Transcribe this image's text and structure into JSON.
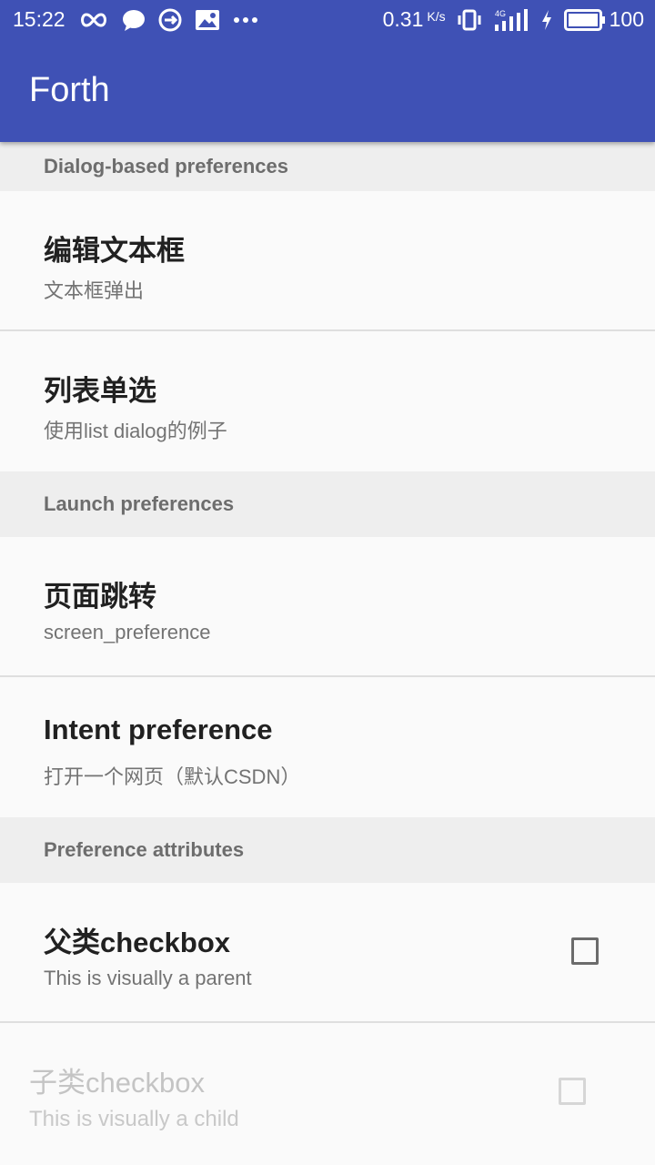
{
  "status_bar": {
    "time": "15:22",
    "net_speed": "0.31",
    "net_unit": "K/s",
    "network_type": "4G",
    "battery_level": "100",
    "left_icons": [
      "infinity-icon",
      "chat-bubble-icon",
      "sync-icon",
      "image-message-icon",
      "more-dots-icon"
    ],
    "right_icons": [
      "vibrate-icon",
      "signal-icon",
      "charging-icon",
      "battery-icon"
    ]
  },
  "app_bar": {
    "title": "Forth",
    "color": "#3f51b5"
  },
  "sections": [
    {
      "header": "Dialog-based preferences",
      "items": [
        {
          "title": "编辑文本框",
          "summary": "文本框弹出"
        },
        {
          "title": "列表单选",
          "summary": "使用list dialog的例子"
        }
      ]
    },
    {
      "header": "Launch preferences",
      "items": [
        {
          "title": "页面跳转",
          "summary": "screen_preference"
        },
        {
          "title": "Intent preference",
          "summary": "打开一个网页（默认CSDN）"
        }
      ]
    },
    {
      "header": "Preference attributes",
      "items": [
        {
          "title": "父类checkbox",
          "summary": "This is visually a parent",
          "checkbox": true,
          "checked": false,
          "enabled": true
        },
        {
          "title": "子类checkbox",
          "summary": "This is visually a child",
          "checkbox": true,
          "checked": false,
          "enabled": false
        }
      ]
    }
  ]
}
